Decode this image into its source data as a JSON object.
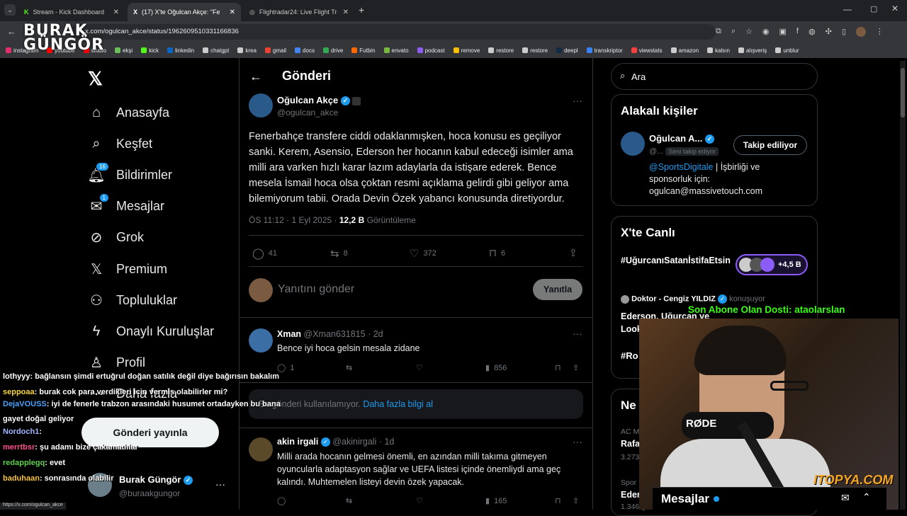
{
  "browser": {
    "tabs": [
      {
        "title": "Stream - Kick Dashboard"
      },
      {
        "title": "(17) X'te Oğulcan Akçe: \"Fenerb"
      },
      {
        "title": "Flightradar24: Live Flight Track"
      }
    ],
    "url": "x.com/ogulcan_akce/status/1962609510331166836",
    "bookmarks": [
      "instagram",
      "youtube",
      "studio",
      "ekşi",
      "kick",
      "linkedin",
      "chatgpt",
      "krea",
      "gmail",
      "docs",
      "drive",
      "Futbin",
      "envato",
      "podcast",
      "remove",
      "restore",
      "restore",
      "deepl",
      "transkriptor",
      "viewstats",
      "amazon",
      "kalsın",
      "alışveriş",
      "unblur"
    ],
    "bookmark_colors": [
      "#e1306c",
      "#ff0000",
      "#ff0000",
      "#6bbf59",
      "#53fc18",
      "#0a66c2",
      "#cccccc",
      "#cccccc",
      "#ea4335",
      "#4285f4",
      "#34a853",
      "#ff6a00",
      "#79b83f",
      "#8b5cf6",
      "#fbbc04",
      "#cccccc",
      "#cccccc",
      "#0f2b46",
      "#3b82f6",
      "#ff4040",
      "#cccccc",
      "#cccccc",
      "#cccccc",
      "#cccccc"
    ]
  },
  "watermark": {
    "line1": "BURAK",
    "line2": "GÜNGÖR"
  },
  "nav": {
    "items": [
      {
        "label": "Anasayfa",
        "icon": "home-icon"
      },
      {
        "label": "Keşfet",
        "icon": "search-icon"
      },
      {
        "label": "Bildirimler",
        "icon": "bell-icon",
        "badge": "16"
      },
      {
        "label": "Mesajlar",
        "icon": "mail-icon",
        "badge": "1"
      },
      {
        "label": "Grok",
        "icon": "grok-icon"
      },
      {
        "label": "Premium",
        "icon": "x-logo-icon"
      },
      {
        "label": "Topluluklar",
        "icon": "people-icon"
      },
      {
        "label": "Onaylı Kuruluşlar",
        "icon": "lightning-icon"
      },
      {
        "label": "Profil",
        "icon": "person-icon"
      },
      {
        "label": "Daha fazla",
        "icon": "more-circle-icon"
      }
    ],
    "post_button": "Gönderi yayınla",
    "account": {
      "name": "Burak Güngör",
      "handle": "@buraakgungor"
    }
  },
  "header": {
    "title": "Gönderi"
  },
  "tweet": {
    "name": "Oğulcan Akçe",
    "handle": "@ogulcan_akce",
    "body": "Fenerbahçe transfere ciddi odaklanmışken, hoca konusu es geçiliyor sanki. Kerem, Asensio, Ederson her hocanın kabul edeceği isimler ama milli ara varken hızlı karar lazım adaylarla da istişare ederek. Bence mesela İsmail hoca olsa çoktan resmi açıklama gelirdi gibi geliyor ama bilemiyorum tabii. Orada Devin Özek yabancı konusunda diretiyordur.",
    "time": "ÖS 11:12 · 1 Eyl 2025",
    "views": "12,2 B",
    "views_label": "Görüntüleme",
    "replies": "41",
    "retweets": "8",
    "likes": "372",
    "bookmarks": "6"
  },
  "reply_box": {
    "placeholder": "Yanıtını gönder",
    "button": "Yanıtla"
  },
  "replies": [
    {
      "name": "Xman",
      "handle": "@Xman631815",
      "time": "2d",
      "text": "Bence iyi hoca gelsin mesala zidane",
      "replies": "1",
      "views": "856"
    },
    {
      "notice": "Bu gönderi kullanılamıyor.",
      "link": "Daha fazla bilgi al"
    },
    {
      "name": "akin irgali",
      "handle": "@akinirgali",
      "time": "1d",
      "text": "Milli arada hocanın gelmesi önemli, en azından milli takıma gitmeyen oyuncularla adaptasyon sağlar ve UEFA listesi içinde önemliydi ama geç kalındı. Muhtemelen listeyi devin özek yapacak.",
      "views": "165"
    }
  ],
  "right": {
    "search_placeholder": "Ara",
    "related_title": "Alakalı kişiler",
    "related": {
      "name": "Oğulcan A...",
      "handle": "@...",
      "follows_you": "Seni takip ediyor",
      "button": "Takip ediliyor",
      "bio_link": "@SportsDigitale",
      "bio": " | İşbirliği ve sponsorluk için: ogulcan@massivetouch.com"
    },
    "live_title": "X'te Canlı",
    "live": [
      {
        "tag": "#UğurcanıSatanİstifaEtsin",
        "count": "+4,5 B"
      },
      {
        "host": "Doktor - Cengiz YILDIZ",
        "status": "konuşuyor",
        "text": "Ederson, Uğurcan ve Looke"
      },
      {
        "tag": "#Ro"
      }
    ],
    "news_title": "Ne",
    "news": [
      {
        "meta": "AC M",
        "title": "Rafa",
        "count": "3.273 g"
      },
      {
        "meta": "Spor · Gündem dahilinde",
        "title": "Ederso",
        "count": "1.346 g"
      }
    ],
    "messages_dock": "Mesajlar"
  },
  "overlay": {
    "subscriber": "Son Abone Olan Dosti: ataolarslan",
    "brand": "ITOPYA.COM",
    "mic_brand": "RØDE",
    "status_url": "https://x.com/ogulcan_akce",
    "chat": [
      {
        "user": "lothyyy",
        "text": ": bağlansın şimdi ertuğrul doğan satılık değil diye bağırısın bakalım",
        "color": "#ffffff"
      },
      {
        "user": "seppoaa",
        "text": ": burak cok para verdikleri icin vermis olabilirler mi?",
        "color": "#f5d63d"
      },
      {
        "user": "DejaVOUSS",
        "text": ": iyi de fenerle trabzon arasındaki husumet ortadayken bu bana",
        "color": "#4aa3ff"
      },
      {
        "user": "",
        "text": "gayet doğal geliyor",
        "color": "#ffffff"
      },
      {
        "user": "Nordoch1",
        "text": ":",
        "color": "#a0b4ff"
      },
      {
        "user": "merrtbsr",
        "text": ": şu adamı bize çakamadılar",
        "color": "#ff4f8a"
      },
      {
        "user": "redapplegq",
        "text": ": evet",
        "color": "#5bd14a"
      },
      {
        "user": "baduhaan",
        "text": ": sonrasında olabilir",
        "color": "#f5c23d"
      }
    ]
  }
}
